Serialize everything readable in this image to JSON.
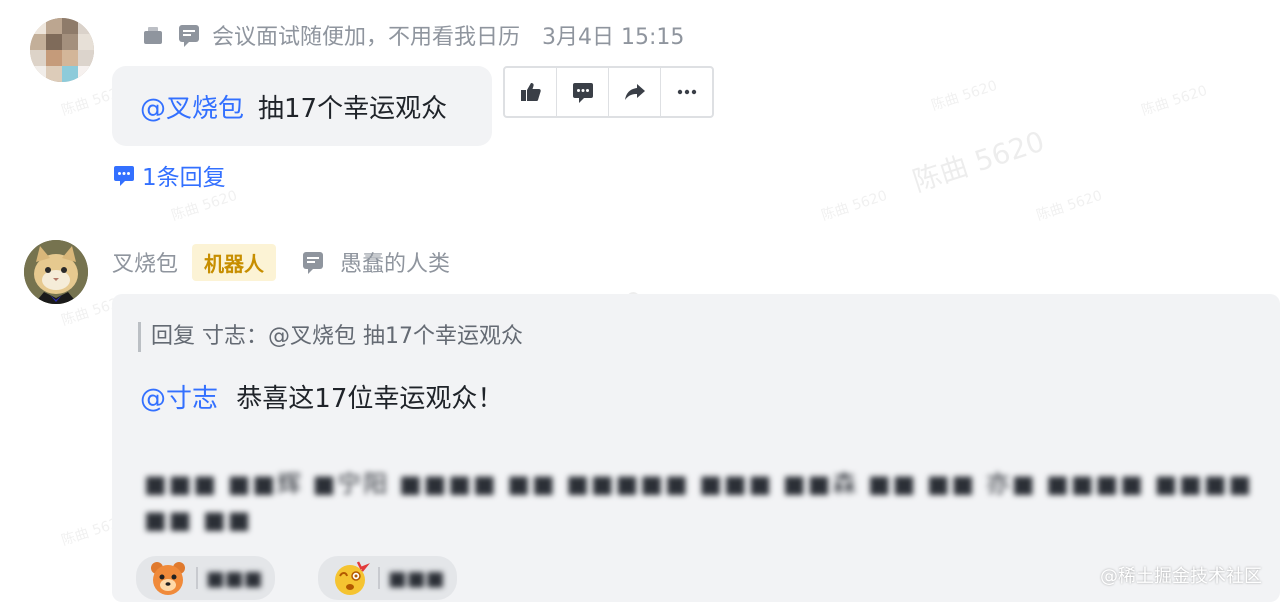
{
  "message1": {
    "meta_text": "会议面试随便加，不用看我日历",
    "timestamp": "3月4日 15:15",
    "mention": "@叉烧包",
    "text": "抽17个幸运观众",
    "reply_count": "1条回复",
    "actions": [
      {
        "name": "thumbs-up-icon"
      },
      {
        "name": "comment-icon"
      },
      {
        "name": "forward-icon"
      },
      {
        "name": "more-icon"
      }
    ]
  },
  "message2": {
    "sender": "叉烧包",
    "badge": "机器人",
    "status_text": "愚蠢的人类",
    "quote": "回复 寸志：@叉烧包 抽17个幸运观众",
    "mention": "@寸志",
    "text": "恭喜这17位幸运观众！",
    "blurred_line1": "■■■ ■■辉 ■宁阳 ■■■■ ■■ ■■■■■ ■■■ ■■森 ■■ ■■ 亦■ ■■■■ ■■■■",
    "blurred_line2": "■■ ■■",
    "reactions": [
      {
        "icon": "bear-emoji-icon",
        "count": "■■■"
      },
      {
        "icon": "dizzy-emoji-icon",
        "count": "■■■"
      }
    ]
  },
  "watermark": {
    "text": "陈曲 5620",
    "footer": "@稀土掘金技术社区"
  },
  "colors": {
    "link": "#3370ff",
    "muted": "#8f959e",
    "bubble": "#f2f3f5",
    "badge_bg": "#fcf3d5",
    "badge_fg": "#c78e00"
  }
}
